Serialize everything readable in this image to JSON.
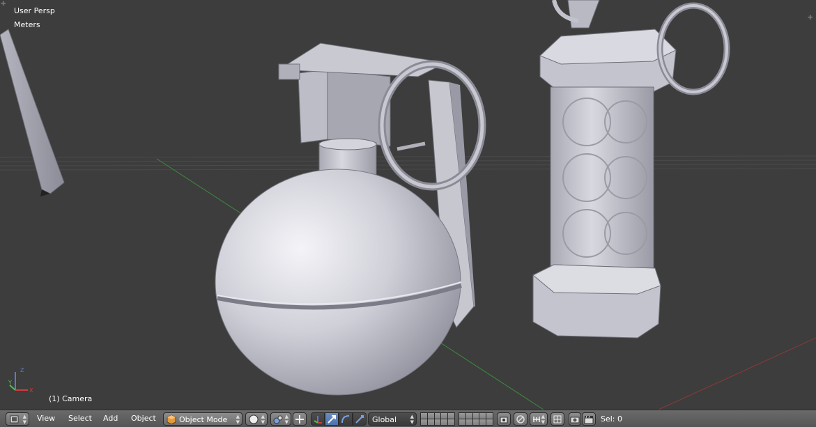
{
  "viewport": {
    "view_name": "User Persp",
    "units": "Meters",
    "active_object": "(1) Camera",
    "axis_labels": {
      "x": "X",
      "y": "Y",
      "z": "Z"
    },
    "axis_colors": {
      "x": "#d23b3b",
      "y": "#4fc24f",
      "z": "#5a78d8"
    },
    "background": "#3d3d3d"
  },
  "header": {
    "menus": {
      "view": "View",
      "select": "Select",
      "add": "Add",
      "object": "Object"
    },
    "mode": "Object Mode",
    "orientation": "Global",
    "selection_status": "Sel: 0",
    "icons": {
      "editor_type": "3d-view-icon",
      "mode": "object-cube-icon",
      "shading": "solid-sphere-icon",
      "pivot": "pivot-point-icon",
      "manipulator": "manipulator-icon",
      "translate": "translate-arrow-icon",
      "rotate": "rotate-arc-icon",
      "scale": "scale-icon",
      "lock_camera": "lock-camera-icon",
      "proportional": "proportional-edit-icon",
      "snap_type": "snap-magnet-icon",
      "snap_target": "snap-target-icon",
      "render": "render-camera-icon",
      "render_anim": "clapper-icon"
    }
  }
}
